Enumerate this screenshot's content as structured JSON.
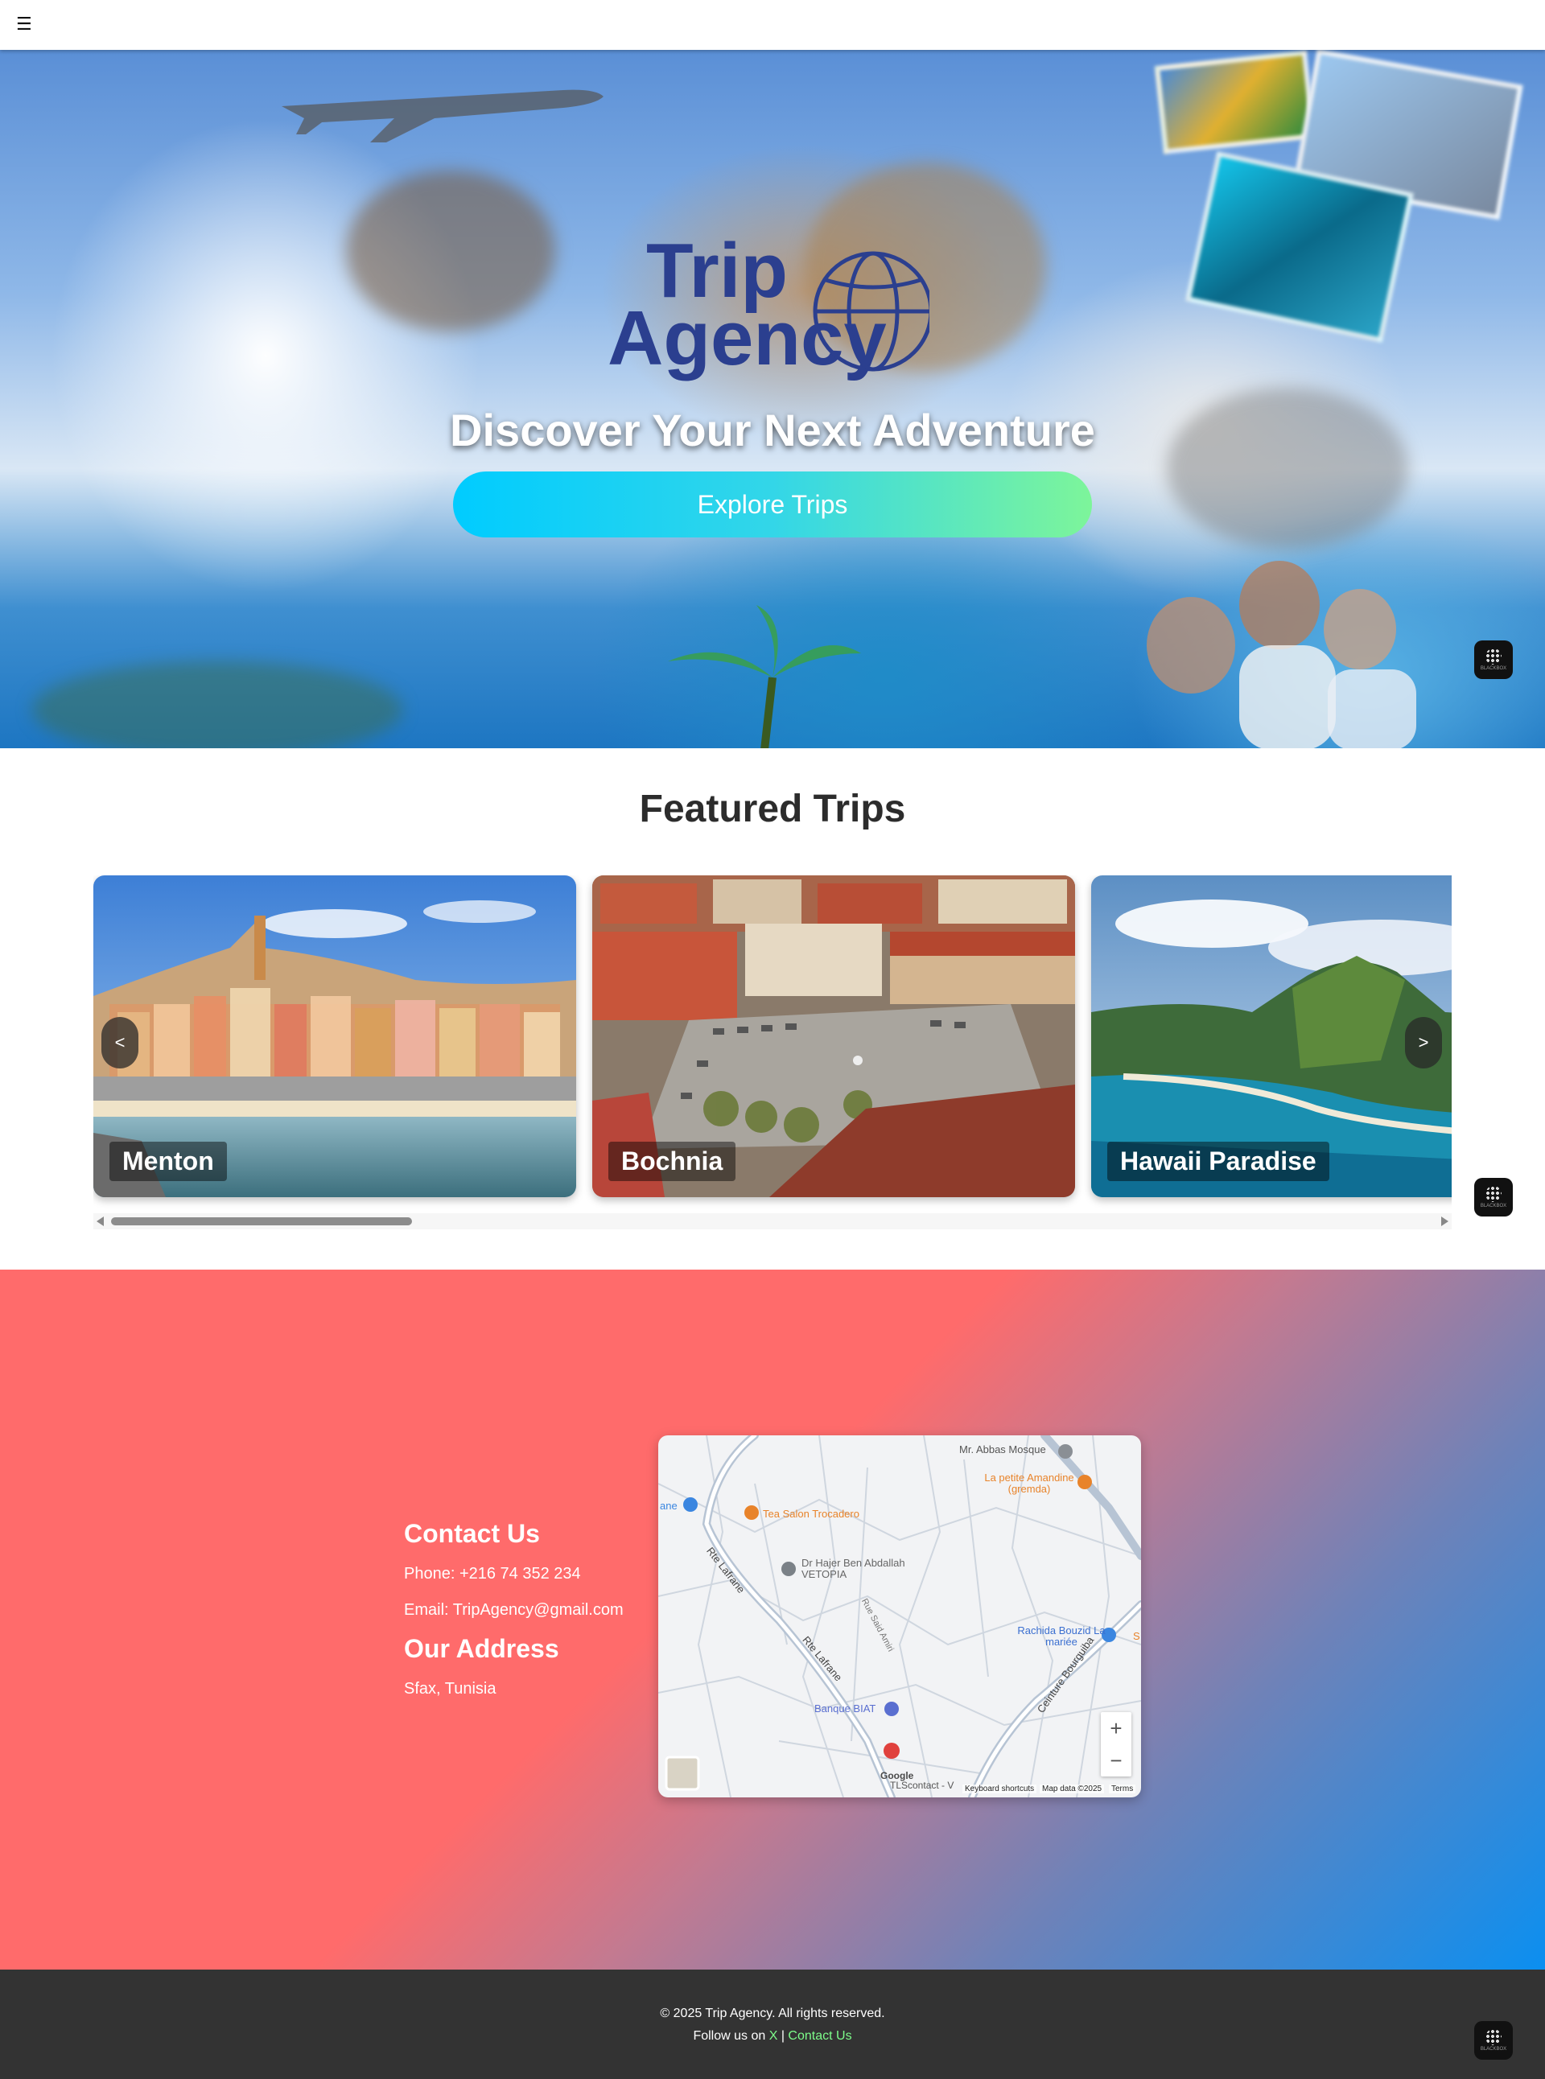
{
  "topbar": {
    "menu_icon": "hamburger-icon",
    "menu_glyph": "☰"
  },
  "hero": {
    "logo_line1": "Trip",
    "logo_line2": "Agency",
    "title": "Discover Your Next Adventure",
    "cta_label": "Explore Trips"
  },
  "featured": {
    "title": "Featured Trips",
    "trips": [
      {
        "name": "Menton"
      },
      {
        "name": "Bochnia"
      },
      {
        "name": "Hawaii Paradise"
      }
    ],
    "prev_label": "<",
    "next_label": ">"
  },
  "contact": {
    "heading": "Contact Us",
    "phone": "Phone: +216 74 352 234",
    "email": "Email: TripAgency@gmail.com",
    "address_heading": "Our Address",
    "address": "Sfax, Tunisia",
    "map": {
      "labels": {
        "mosque": "Mr. Abbas Mosque",
        "restaurant": "La petite Amandine (gremda)",
        "tea": "Tea Salon Trocadero",
        "doctor": "Dr Hajer Ben Abdallah VETOPIA",
        "road1": "Rte Lafrane",
        "road2": "Rte Lafrane",
        "road3": "Rue Said Amiri",
        "road4": "Ceinture Bourguiba",
        "rachida": "Rachida Bouzid La mariée",
        "bank": "Banque BIAT",
        "tls": "TLScontact - V",
        "google": "Google",
        "ane": "ane",
        "s": "S"
      },
      "zoom_in": "+",
      "zoom_out": "−",
      "footer_shortcuts": "Keyboard shortcuts",
      "footer_data": "Map data ©2025",
      "footer_terms": "Terms"
    }
  },
  "footer": {
    "copyright": "© 2025 Trip Agency. All rights reserved.",
    "follow_prefix": "Follow us on ",
    "x_link": "X",
    "separator": " | ",
    "contact_link": "Contact Us"
  },
  "badges": {
    "text": "BLACKBOX"
  },
  "colors": {
    "accent_cyan": "#00ccff",
    "accent_green": "#7df59a",
    "contact_coral": "#ff6b6b",
    "contact_blue": "#0b8ff0",
    "footer_bg": "#333333",
    "footer_link": "#7dfc8a",
    "logo_blue": "#2b3f8f"
  }
}
